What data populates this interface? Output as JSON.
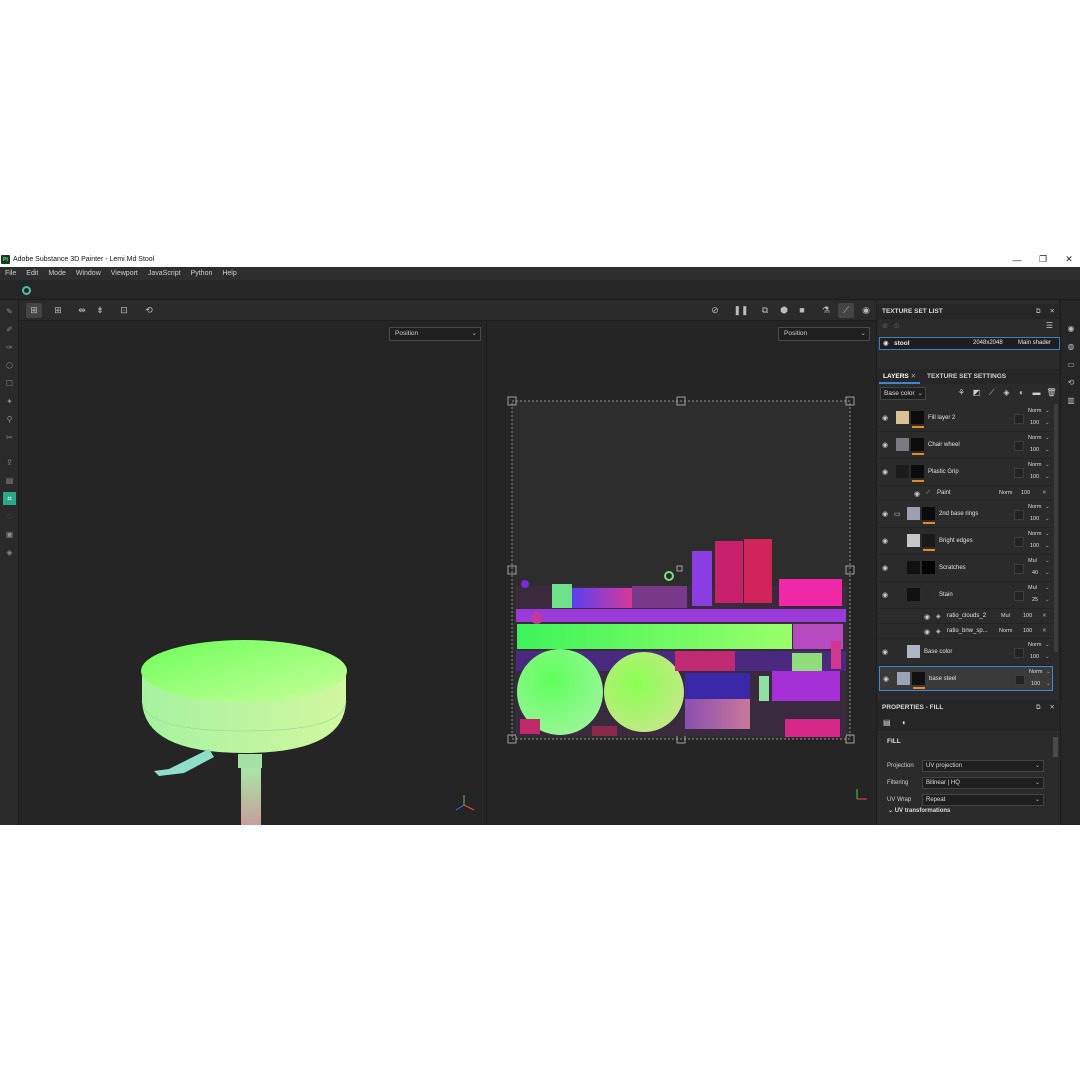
{
  "window": {
    "logo": "Pt",
    "title": "Adobe Substance 3D Painter - Lemi Md Stool",
    "minimize": "—",
    "restore": "❐",
    "close": "✕"
  },
  "menu": [
    "File",
    "Edit",
    "Mode",
    "Window",
    "Viewport",
    "JavaScript",
    "Python",
    "Help"
  ],
  "viewport3d": {
    "mode": "Position"
  },
  "viewport2d": {
    "mode": "Position"
  },
  "texture_set_list": {
    "title": "TEXTURE SET LIST",
    "set_name": "stool",
    "resolution": "2048x2048",
    "shader": "Main shader"
  },
  "tabs": {
    "layers": "LAYERS",
    "texture_set_settings": "TEXTURE SET SETTINGS"
  },
  "channel": "Base color",
  "layers": [
    {
      "name": "Fill layer 2",
      "blend": "Norm",
      "opacity": "100"
    },
    {
      "name": "Chair wheel",
      "blend": "Norm",
      "opacity": "100"
    },
    {
      "name": "Plastic Grip",
      "blend": "Norm",
      "opacity": "100"
    },
    {
      "name": "Paint",
      "blend": "Norm",
      "opacity": "100"
    },
    {
      "name": "2nd base rings",
      "blend": "Norm",
      "opacity": "100"
    },
    {
      "name": "Bright edges",
      "blend": "Norm",
      "opacity": "100"
    },
    {
      "name": "Scratches",
      "blend": "Mul",
      "opacity": "40"
    },
    {
      "name": "Stain",
      "blend": "Mul",
      "opacity": "25"
    },
    {
      "name": "ratio_clouds_2",
      "blend": "Mul",
      "opacity": "100"
    },
    {
      "name": "ratio_bnw_sp...",
      "blend": "Norm",
      "opacity": "100"
    },
    {
      "name": "Base color",
      "blend": "Norm",
      "opacity": "100"
    },
    {
      "name": "base steel",
      "blend": "Norm",
      "opacity": "100"
    }
  ],
  "properties": {
    "title": "PROPERTIES - FILL",
    "section": "FILL",
    "fields": [
      {
        "label": "Projection",
        "value": "UV projection"
      },
      {
        "label": "Filtering",
        "value": "Bilinear | HQ"
      },
      {
        "label": "UV Wrap",
        "value": "Repeat"
      }
    ],
    "uv_transformations": "UV transformations"
  },
  "colors": {
    "accent_teal": "#2aa889",
    "selection_blue": "#3b86d6",
    "layer_bar_orange": "#e38a2c",
    "panel_bg": "#2b2b2b",
    "viewport_bg": "#252525"
  },
  "icons": [
    "brush-icon",
    "eraser-icon",
    "eye-icon",
    "pause-icon",
    "camera-icon",
    "trash-icon",
    "folder-icon",
    "add-layer-icon",
    "close-icon",
    "menu-icon"
  ]
}
